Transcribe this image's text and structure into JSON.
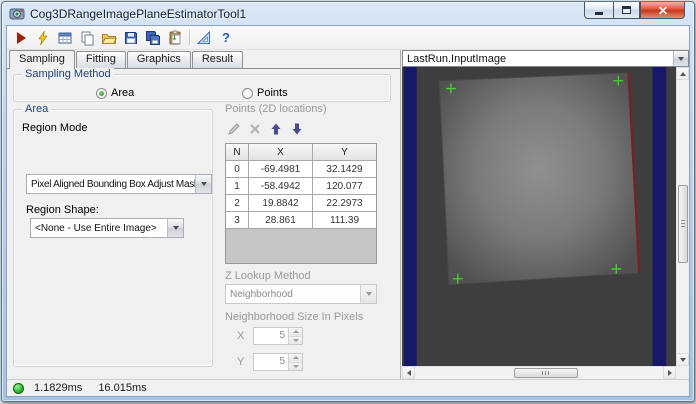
{
  "window": {
    "title": "Cog3DRangeImagePlaneEstimatorTool1"
  },
  "toolbar": {
    "icon_names": [
      "run",
      "lightning",
      "results-grid",
      "copy",
      "open",
      "save",
      "save-all",
      "paste",
      "measure",
      "help"
    ],
    "help_glyph": "?"
  },
  "tabs": {
    "active": "Sampling",
    "items": [
      {
        "label": "Sampling"
      },
      {
        "label": "Fitting"
      },
      {
        "label": "Graphics"
      },
      {
        "label": "Result"
      }
    ]
  },
  "sampling_method": {
    "label": "Sampling Method",
    "options": [
      {
        "label": "Area",
        "selected": true
      },
      {
        "label": "Points",
        "selected": false
      }
    ]
  },
  "area_group": {
    "label": "Area",
    "region_mode_label": "Region Mode",
    "region_mode_value": "Pixel Aligned Bounding Box Adjust Mask",
    "region_shape_label": "Region Shape:",
    "region_shape_value": "<None - Use Entire Image>"
  },
  "points_group": {
    "label": "Points (2D locations)",
    "icon_names": [
      "edit-point",
      "delete-point",
      "move-point-up",
      "move-point-down"
    ],
    "table": {
      "headers": [
        "N",
        "X",
        "Y"
      ],
      "rows": [
        [
          "0",
          "-69.4981",
          "32.1429"
        ],
        [
          "1",
          "-58.4942",
          "120.077"
        ],
        [
          "2",
          "19.8842",
          "22.2973"
        ],
        [
          "3",
          "28.861",
          "111.39"
        ]
      ]
    }
  },
  "z_lookup": {
    "label": "Z Lookup Method",
    "value": "Neighborhood"
  },
  "neighborhood": {
    "label": "Neighborhood Size In Pixels",
    "x_label": "X",
    "x_value": "5",
    "y_label": "Y",
    "y_value": "5"
  },
  "image_panel": {
    "display_selection": "LastRun.InputImage"
  },
  "status_bar": {
    "items": [
      "1.1829ms",
      "16.015ms"
    ]
  },
  "colors": {
    "image_border_navy": "#181868",
    "marker_green": "#44d62c",
    "edge_red": "#7d1f1f",
    "run_red": "#a61e0f"
  }
}
